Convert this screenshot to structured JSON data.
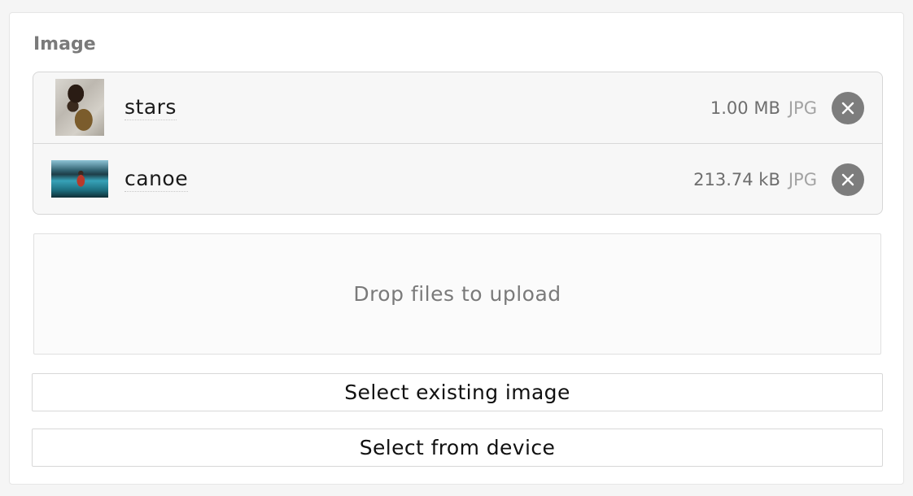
{
  "field": {
    "label": "Image"
  },
  "files": [
    {
      "name": "stars",
      "size": "1.00 MB",
      "type": "JPG",
      "thumbnail": "portrait-photo"
    },
    {
      "name": "canoe",
      "size": "213.74 kB",
      "type": "JPG",
      "thumbnail": "canoe-lake-photo"
    }
  ],
  "icons": {
    "remove": "close-icon"
  },
  "dropzone": {
    "text": "Drop files to upload"
  },
  "actions": {
    "select_existing": "Select existing image",
    "select_device": "Select from device"
  }
}
